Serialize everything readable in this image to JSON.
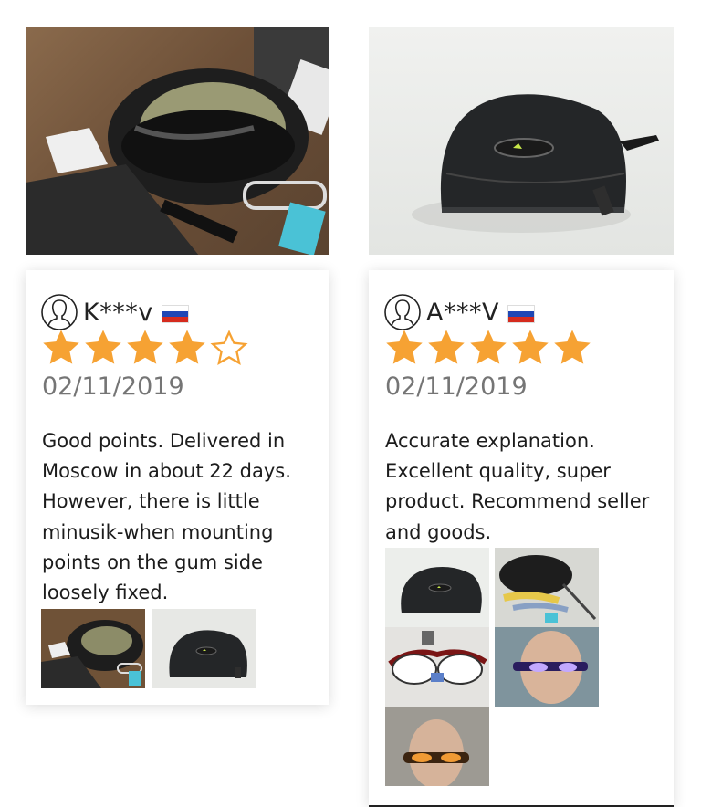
{
  "reviews": [
    {
      "name": "K***v",
      "country_flag": "russia-flag",
      "rating": 4,
      "rating_max": 5,
      "date": "02/11/2019",
      "text": "Good points. Delivered in Moscow in about 22 days. However, there is little minusik-when mounting points on the gum side loosely fixed.",
      "photos": [
        "glasses-kit-photo",
        "glasses-case-photo"
      ]
    },
    {
      "name": "A***V",
      "country_flag": "russia-flag",
      "rating": 5,
      "rating_max": 5,
      "date": "02/11/2019",
      "text": "Accurate explanation. Excellent quality, super product. Recommend seller and goods.",
      "photos": [
        "glasses-case-photo",
        "lenses-set-photo",
        "red-frame-glasses-photo",
        "man-wearing-glasses-photo",
        "man-wearing-orange-glasses-photo"
      ]
    }
  ],
  "colors": {
    "star": "#F6A233",
    "date": "#757575",
    "text": "#1c1c1c"
  },
  "icons": {
    "avatar": "user-avatar-icon",
    "star": "star-icon"
  }
}
